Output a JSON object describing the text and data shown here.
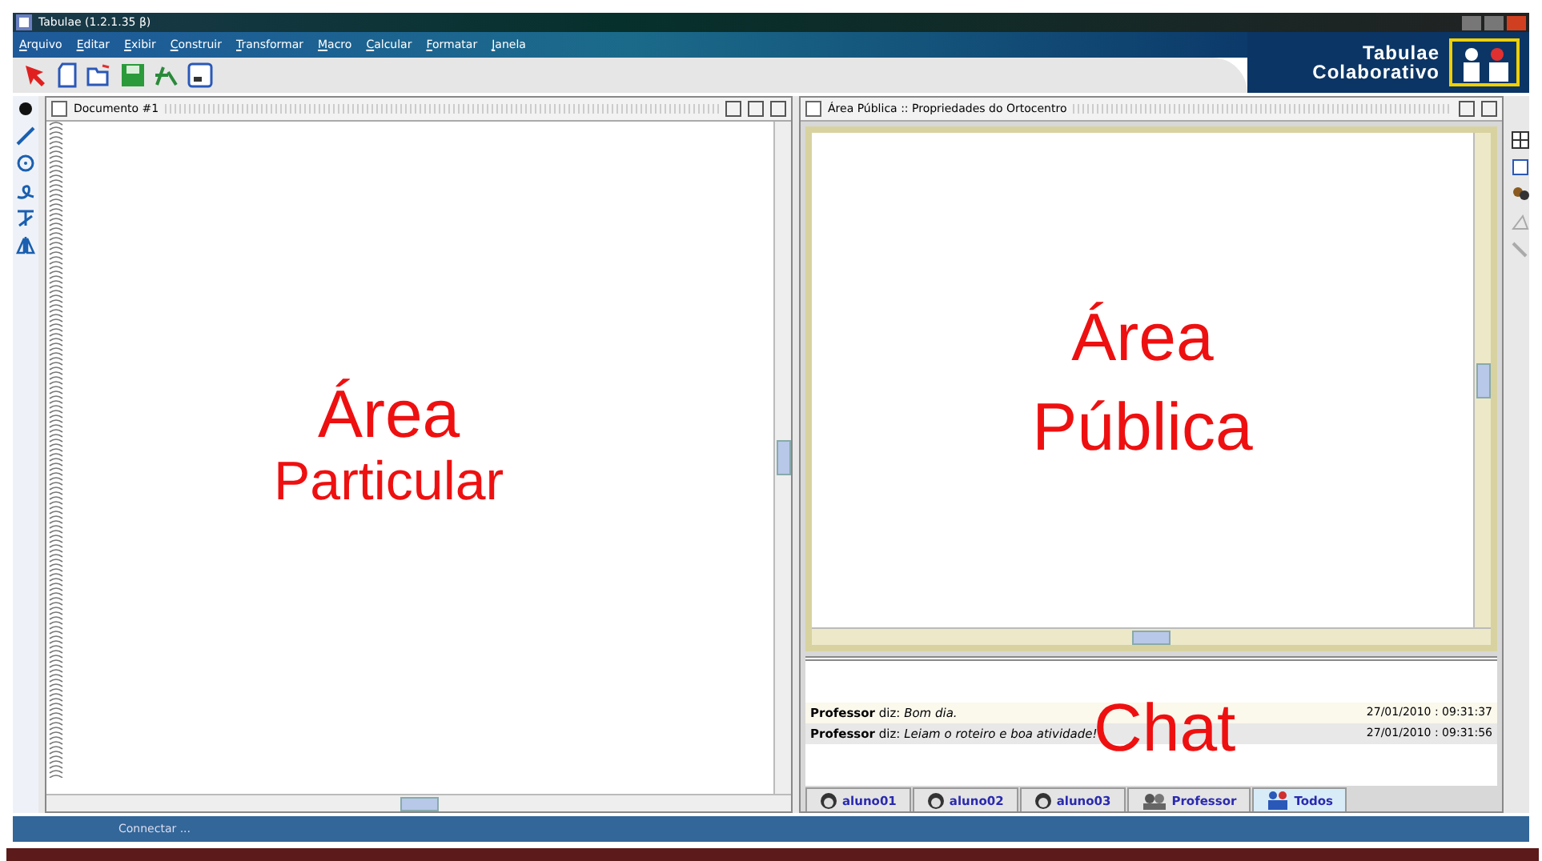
{
  "window": {
    "title": "Tabulae (1.2.1.35 β)"
  },
  "menu": [
    "Arquivo",
    "Editar",
    "Exibir",
    "Construir",
    "Transformar",
    "Macro",
    "Calcular",
    "Formatar",
    "Janela"
  ],
  "banner": {
    "line_1": "Tabulae",
    "line_2": "Colaborativo"
  },
  "private_area": {
    "checked": false,
    "title": "Documento #1",
    "label_1": "Área",
    "label_2": "Particular"
  },
  "public_area": {
    "checked": false,
    "title": "Área Pública :: Propriedades do Ortocentro",
    "label_1": "Área",
    "label_2": "Pública"
  },
  "chat": {
    "label": "Chat",
    "messages": [
      {
        "author": "Professor",
        "verb": "diz:",
        "text": "Bom dia.",
        "time": "27/01/2010 : 09:31:37"
      },
      {
        "author": "Professor",
        "verb": "diz:",
        "text": "Leiam o roteiro e boa atividade!",
        "time": "27/01/2010 : 09:31:56"
      }
    ]
  },
  "tabs": [
    {
      "label": "aluno01",
      "selected": false,
      "kind": "student"
    },
    {
      "label": "aluno02",
      "selected": false,
      "kind": "student"
    },
    {
      "label": "aluno03",
      "selected": false,
      "kind": "student"
    },
    {
      "label": "Professor",
      "selected": false,
      "kind": "teacher"
    },
    {
      "label": "Todos",
      "selected": true,
      "kind": "group"
    }
  ],
  "status": "Connectar ..."
}
